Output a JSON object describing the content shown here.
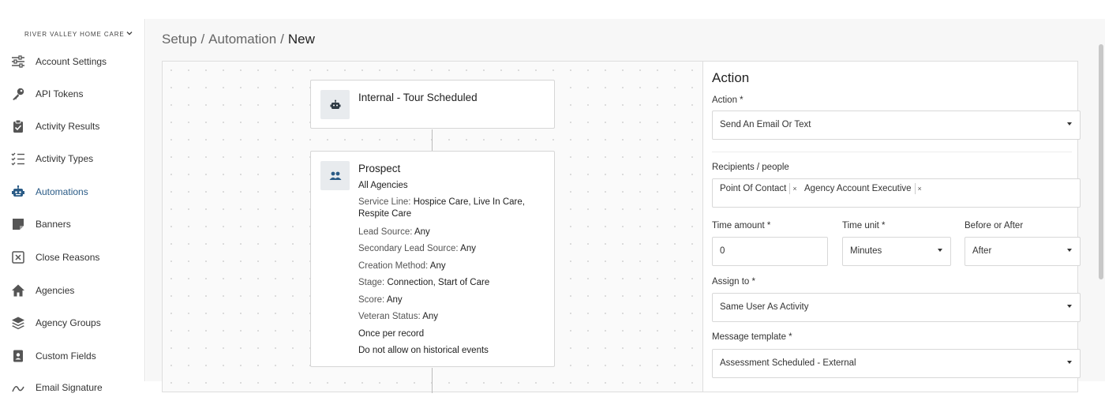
{
  "org": {
    "name": "RIVER VALLEY HOME CARE",
    "chevron": "chevron-down-icon"
  },
  "nav": {
    "items": [
      {
        "label": "Account Settings",
        "icon": "sliders-icon"
      },
      {
        "label": "API Tokens",
        "icon": "key-icon"
      },
      {
        "label": "Activity Results",
        "icon": "clipboard-check-icon"
      },
      {
        "label": "Activity Types",
        "icon": "checklist-icon"
      },
      {
        "label": "Automations",
        "icon": "robot-icon",
        "active": true
      },
      {
        "label": "Banners",
        "icon": "note-icon"
      },
      {
        "label": "Close Reasons",
        "icon": "x-square-icon"
      },
      {
        "label": "Agencies",
        "icon": "home-icon"
      },
      {
        "label": "Agency Groups",
        "icon": "layers-icon"
      },
      {
        "label": "Custom Fields",
        "icon": "id-badge-icon"
      },
      {
        "label": "Email Signature",
        "icon": "signature-icon"
      }
    ]
  },
  "breadcrumb": {
    "parts": [
      "Setup",
      "Automation",
      "New"
    ],
    "sep": "/"
  },
  "trigger": {
    "title": "Internal - Tour Scheduled",
    "icon": "robot-icon"
  },
  "prospect": {
    "title": "Prospect",
    "icon": "users-icon",
    "agencies": "All Agencies",
    "service_line_label": "Service Line: ",
    "service_line_value": "Hospice Care, Live In Care, Respite Care",
    "lead_source_label": "Lead Source: ",
    "lead_source_value": "Any",
    "secondary_lead_source_label": "Secondary Lead Source: ",
    "secondary_lead_source_value": "Any",
    "creation_method_label": "Creation Method: ",
    "creation_method_value": "Any",
    "stage_label": "Stage: ",
    "stage_value": "Connection, Start of Care",
    "score_label": "Score: ",
    "score_value": "Any",
    "veteran_status_label": "Veteran Status: ",
    "veteran_status_value": "Any",
    "frequency": "Once per record",
    "historical": "Do not allow on historical events"
  },
  "action_panel": {
    "heading": "Action",
    "action_label": "Action *",
    "action_value": "Send An Email Or Text",
    "recipients_label": "Recipients / people",
    "recipients": [
      "Point Of Contact",
      "Agency Account Executive"
    ],
    "remove_symbol": "×",
    "time_amount_label": "Time amount *",
    "time_amount_value": "0",
    "time_unit_label": "Time unit *",
    "time_unit_value": "Minutes",
    "before_after_label": "Before or After",
    "before_after_value": "After",
    "assign_to_label": "Assign to *",
    "assign_to_value": "Same User As Activity",
    "message_template_label": "Message template *",
    "message_template_value": "Assessment Scheduled - External"
  }
}
